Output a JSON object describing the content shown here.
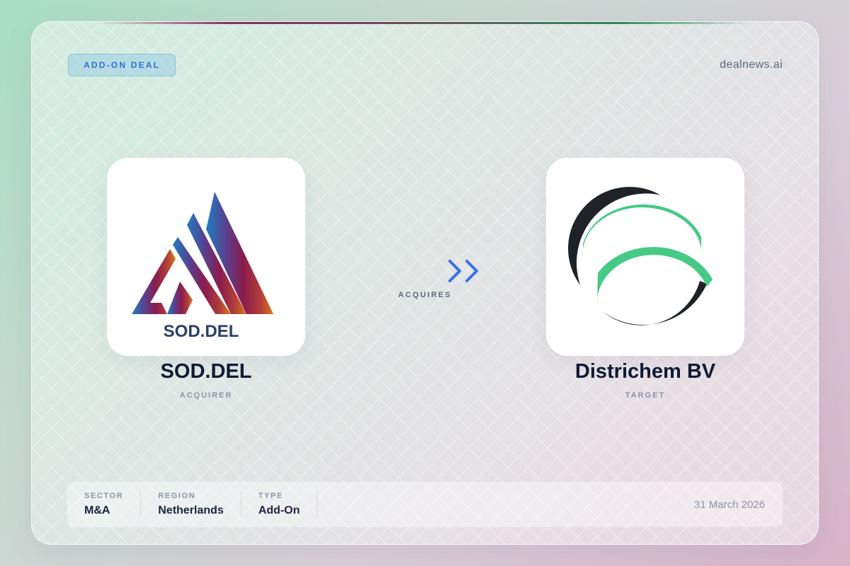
{
  "badge": {
    "label": "ADD-ON DEAL"
  },
  "brand": {
    "text": "dealnews.ai"
  },
  "acquirer": {
    "name": "SOD.DEL",
    "role": "ACQUIRER",
    "logo_text": "SOD.DEL"
  },
  "target": {
    "name": "Districhem BV",
    "role": "TARGET"
  },
  "arrow": {
    "label": "ACQUIRES"
  },
  "info": {
    "sector": {
      "label": "SECTOR",
      "value": "M&A"
    },
    "region": {
      "label": "REGION",
      "value": "Netherlands"
    },
    "type": {
      "label": "TYPE",
      "value": "Add-On"
    },
    "date": "31 March 2026"
  },
  "colors": {
    "accent_blue": "#2f6fd8",
    "arrow_blue": "#3b6fe6",
    "target_green": "#45c985",
    "target_dark": "#1f2328"
  }
}
